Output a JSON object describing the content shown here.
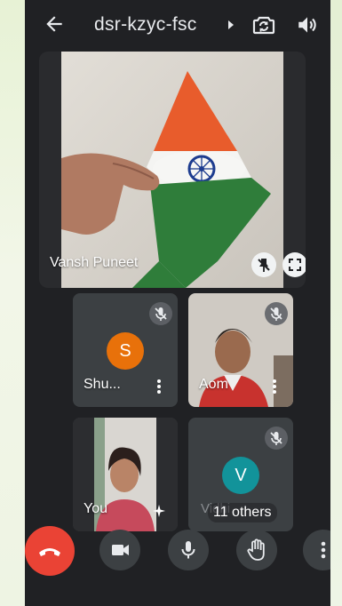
{
  "call": {
    "meeting_code": "dsr-kzyc-fsc"
  },
  "main_tile": {
    "participant_name": "Vansh Puneet"
  },
  "tiles": [
    {
      "name": "Shu...",
      "avatar_letter": "S",
      "avatar_color": "#e8710a"
    },
    {
      "name": "Aom"
    },
    {
      "name": "You"
    },
    {
      "name": "Vidhi",
      "avatar_letter": "V",
      "avatar_color": "#12939a",
      "others_label": "11 others"
    }
  ],
  "colors": {
    "end_call": "#ea4335",
    "control_bg": "#3c4043",
    "screen_bg": "#202124"
  },
  "icons": {
    "back": "arrow-left-icon",
    "switch_camera": "switch-camera-icon",
    "audio": "speaker-icon",
    "end_call": "phone-hangup-icon",
    "camera": "video-camera-icon",
    "mic": "microphone-icon",
    "raise_hand": "hand-icon",
    "more": "more-vert-icon"
  }
}
